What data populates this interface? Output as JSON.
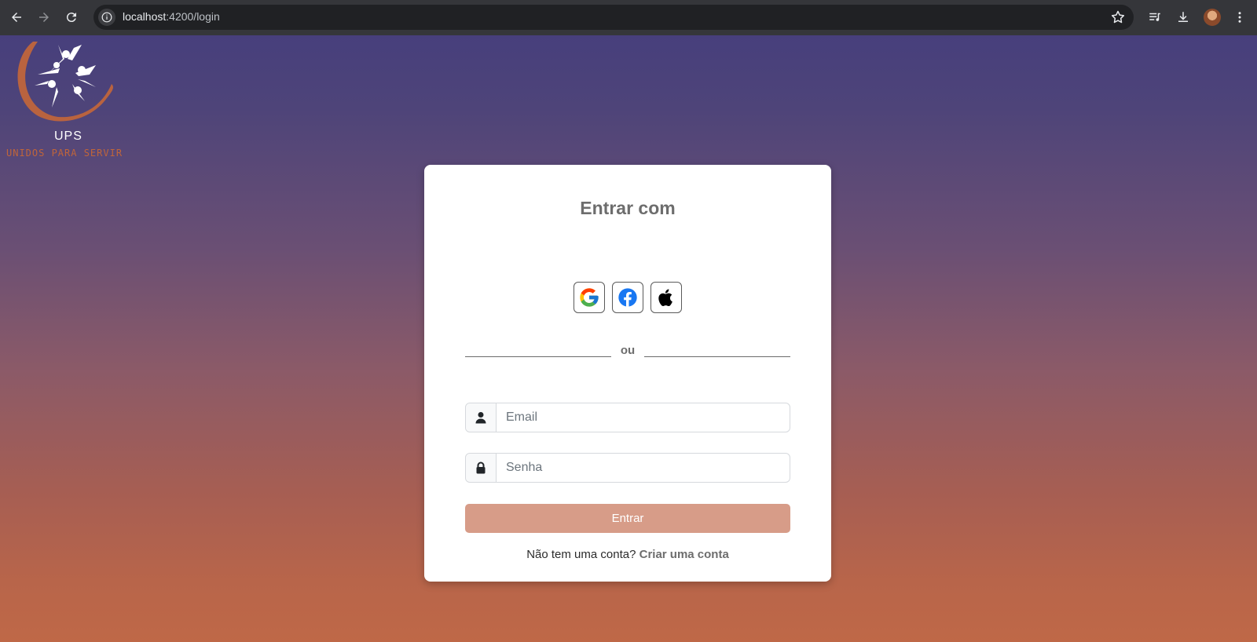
{
  "browser": {
    "url_host": "localhost",
    "url_path": ":4200/login"
  },
  "logo": {
    "name": "UPS",
    "tagline": "UNIDOS PARA SERVIR"
  },
  "login": {
    "title": "Entrar com",
    "social": [
      "google",
      "facebook",
      "apple"
    ],
    "divider": "ou",
    "email_placeholder": "Email",
    "password_placeholder": "Senha",
    "submit_label": "Entrar",
    "signup_prompt": "Não tem uma conta?",
    "signup_link": "Criar uma conta"
  },
  "colors": {
    "submit_button": "#d79c88",
    "gradient_top": "#473f7c",
    "gradient_bottom": "#bf6847"
  }
}
